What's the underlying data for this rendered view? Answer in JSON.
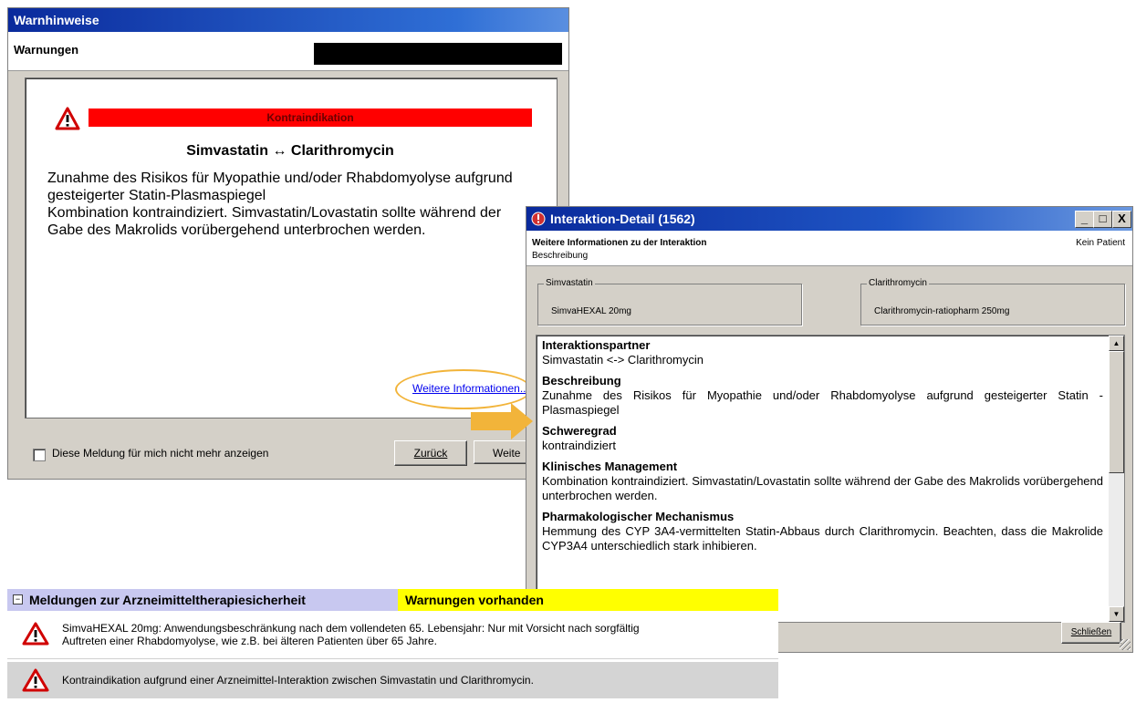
{
  "warn_window": {
    "title": "Warnhinweise",
    "section_label": "Warnungen",
    "severity_label": "Kontraindikation",
    "drug_pair": "Simvastatin ↔ Clarithromycin",
    "description_lines": [
      "Zunahme des Risikos für Myopathie und/oder Rhabdomyolyse aufgrund",
      "gesteigerter Statin-Plasmaspiegel",
      "Kombination kontraindiziert. Simvastatin/Lovastatin sollte während der",
      "Gabe des Makrolids vorübergehend unterbrochen werden."
    ],
    "more_info_link": "Weitere Informationen...",
    "checkbox_label": "Diese Meldung für mich nicht mehr anzeigen",
    "back_button": "Zurück",
    "next_button": "Weite",
    "highlight_color": "#f2b43a",
    "severity_color": "#ff0000"
  },
  "detail_window": {
    "title": "Interaktion-Detail (1562)",
    "header_title": "Weitere Informationen zu der Interaktion",
    "header_sub": "Beschreibung",
    "patient": "Kein Patient",
    "group1_label": "Simvastatin",
    "group1_value": "SimvaHEXAL 20mg",
    "group2_label": "Clarithromycin",
    "group2_value": "Clarithromycin-ratiopharm 250mg",
    "sections": [
      {
        "heading": "Interaktionspartner",
        "text": "Simvastatin <-> Clarithromycin"
      },
      {
        "heading": "Beschreibung",
        "text": "Zunahme des Risikos für Myopathie und/oder Rhabdomyolyse aufgrund gesteigerter Statin -Plasmaspiegel"
      },
      {
        "heading": "Schweregrad",
        "text": "kontraindiziert"
      },
      {
        "heading": "Klinisches Management",
        "text": "Kombination kontraindiziert. Simvastatin/Lovastatin sollte während der Gabe des Makrolids vorübergehend unterbrochen werden."
      },
      {
        "heading": "Pharmakologischer Mechanismus",
        "text": "Hemmung des CYP 3A4-vermittelten Statin-Abbaus durch Clarithromycin. Beachten, dass die Makrolide CYP3A4 unterschiedlich stark inhibieren."
      }
    ],
    "close_button": "Schließen",
    "minimize_glyph": "_",
    "maximize_glyph": "□",
    "close_glyph": "X"
  },
  "messages_panel": {
    "collapse_glyph": "−",
    "title": "Meldungen zur Arzneimitteltherapiesicherheit",
    "status": "Warnungen vorhanden",
    "status_color": "#ffff00",
    "rows": [
      {
        "line1": "SimvaHEXAL 20mg: Anwendungsbeschränkung nach dem vollendeten 65. Lebensjahr: Nur mit Vorsicht nach sorgfältig",
        "line2": "Auftreten einer Rhabdomyolyse, wie z.B. bei älteren Patienten über 65 Jahre.",
        "icon": "warning-triangle-icon"
      },
      {
        "line1": "Kontraindikation aufgrund einer Arzneimittel-Interaktion zwischen Simvastatin und Clarithromycin.",
        "icon": "warning-triangle-icon"
      }
    ]
  }
}
